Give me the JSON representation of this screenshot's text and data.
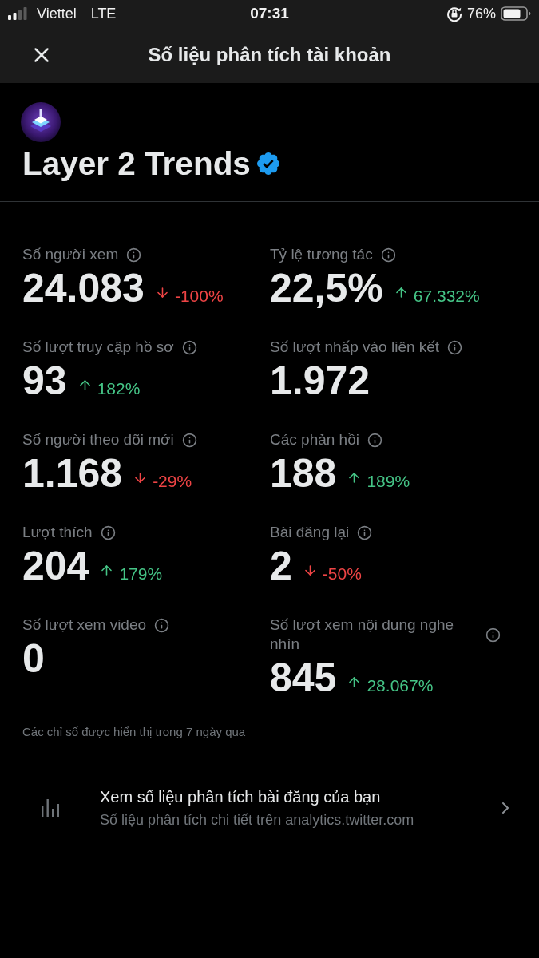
{
  "status_bar": {
    "carrier": "Viettel",
    "network": "LTE",
    "time": "07:31",
    "battery": "76%"
  },
  "header": {
    "title": "Số liệu phân tích tài khoản"
  },
  "profile": {
    "name": "Layer 2 Trends",
    "verified": true
  },
  "metrics": [
    {
      "label": "Số người xem",
      "value": "24.083",
      "change": "-100%",
      "increase": false
    },
    {
      "label": "Tỷ lệ tương tác",
      "value": "22,5%",
      "change": "67.332%",
      "increase": true
    },
    {
      "label": "Số lượt truy cập hồ sơ",
      "value": "93",
      "change": "182%",
      "increase": true
    },
    {
      "label": "Số lượt nhấp vào liên kết",
      "value": "1.972"
    },
    {
      "label": "Số người theo dõi mới",
      "value": "1.168",
      "change": "-29%",
      "increase": false
    },
    {
      "label": "Các phản hồi",
      "value": "188",
      "change": "189%",
      "increase": true
    },
    {
      "label": "Lượt thích",
      "value": "204",
      "change": "179%",
      "increase": true
    },
    {
      "label": "Bài đăng lại",
      "value": "2",
      "change": "-50%",
      "increase": false
    },
    {
      "label": "Số lượt xem video",
      "value": "0"
    },
    {
      "label": "Số lượt xem nội dung nghe nhìn",
      "value": "845",
      "change": "28.067%",
      "increase": true
    }
  ],
  "footnote": "Các chỉ số được hiển thị trong 7 ngày qua",
  "analytics_link": {
    "title": "Xem số liệu phân tích bài đăng của bạn",
    "subtitle": "Số liệu phân tích chi tiết trên analytics.twitter.com"
  }
}
